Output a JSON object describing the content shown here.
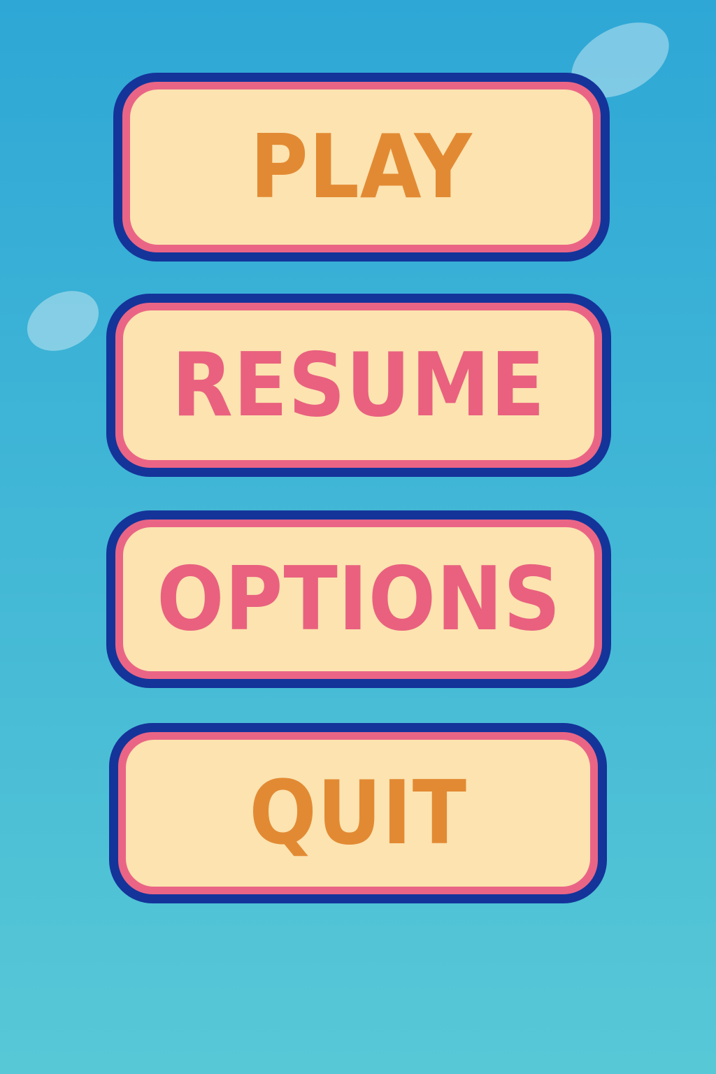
{
  "menu": {
    "buttons": [
      {
        "label": "PLAY",
        "text_color": "#e28a33"
      },
      {
        "label": "RESUME",
        "text_color": "#e9617f"
      },
      {
        "label": "OPTIONS",
        "text_color": "#e9617f"
      },
      {
        "label": "QUIT",
        "text_color": "#e28a33"
      }
    ]
  },
  "colors": {
    "background_top": "#2ea7d6",
    "background_bottom": "#57c8d6",
    "button_outline": "#14349a",
    "button_border": "#ea6585",
    "button_fill": "#fce3b0"
  }
}
